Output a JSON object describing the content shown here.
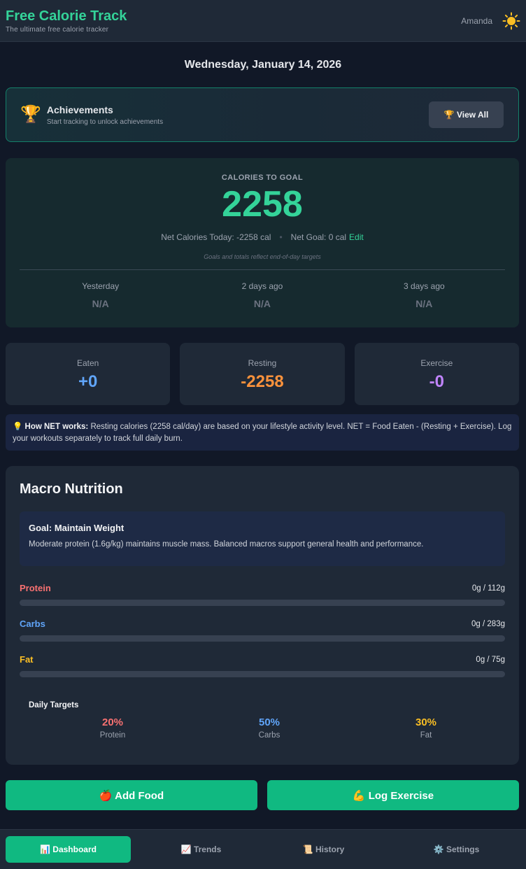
{
  "header": {
    "title": "Free Calorie Track",
    "subtitle": "The ultimate free calorie tracker",
    "user": "Amanda",
    "theme_icon": "sun-icon"
  },
  "date": "Wednesday, January 14, 2026",
  "achievements": {
    "icon": "🏆",
    "title": "Achievements",
    "subtitle": "Start tracking to unlock achievements",
    "button": "🏆 View All"
  },
  "goal": {
    "label": "CALORIES TO GOAL",
    "value": "2258",
    "net_today": "Net Calories Today: -2258 cal",
    "net_goal": "Net Goal: 0 cal",
    "edit": "Edit",
    "note": "Goals and totals reflect end-of-day targets",
    "history": [
      {
        "label": "Yesterday",
        "value": "N/A"
      },
      {
        "label": "2 days ago",
        "value": "N/A"
      },
      {
        "label": "3 days ago",
        "value": "N/A"
      }
    ]
  },
  "stats": [
    {
      "label": "Eaten",
      "value": "+0",
      "color": "#60a5fa"
    },
    {
      "label": "Resting",
      "value": "-2258",
      "color": "#fb923c"
    },
    {
      "label": "Exercise",
      "value": "-0",
      "color": "#c084fc"
    }
  ],
  "info": {
    "icon": "💡",
    "bold": "How NET works:",
    "text": " Resting calories (2258 cal/day) are based on your lifestyle activity level. NET = Food Eaten - (Resting + Exercise). Log your workouts separately to track full daily burn."
  },
  "macros": {
    "title": "Macro Nutrition",
    "goal_title": "Goal: Maintain Weight",
    "goal_desc": "Moderate protein (1.6g/kg) maintains muscle mass. Balanced macros support general health and performance.",
    "items": [
      {
        "name": "Protein",
        "amount": "0g / 112g",
        "color": "#f87171",
        "progress": 0
      },
      {
        "name": "Carbs",
        "amount": "0g / 283g",
        "color": "#60a5fa",
        "progress": 0
      },
      {
        "name": "Fat",
        "amount": "0g / 75g",
        "color": "#fbbf24",
        "progress": 0
      }
    ],
    "targets_title": "Daily Targets",
    "targets": [
      {
        "pct": "20%",
        "name": "Protein",
        "color": "#f87171"
      },
      {
        "pct": "50%",
        "name": "Carbs",
        "color": "#60a5fa"
      },
      {
        "pct": "30%",
        "name": "Fat",
        "color": "#fbbf24"
      }
    ]
  },
  "actions": {
    "add_food": "🍎 Add Food",
    "log_exercise": "💪 Log Exercise"
  },
  "nav": [
    {
      "label": "📊 Dashboard",
      "active": true
    },
    {
      "label": "📈 Trends",
      "active": false
    },
    {
      "label": "📜 History",
      "active": false
    },
    {
      "label": "⚙️ Settings",
      "active": false
    }
  ]
}
